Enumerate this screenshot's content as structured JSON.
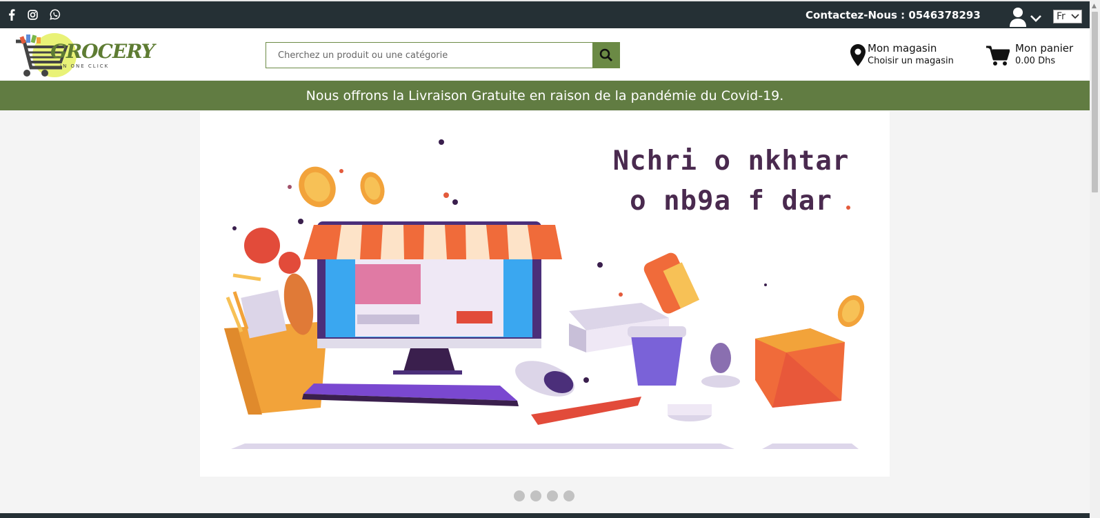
{
  "topbar": {
    "contact": "Contactez-Nous : 0546378293",
    "language": "Fr",
    "icons": [
      "facebook-icon",
      "instagram-icon",
      "whatsapp-icon",
      "user-icon",
      "chevron-down-icon"
    ]
  },
  "header": {
    "logo_text": "GROCERY",
    "logo_tagline": "IN ONE CLICK",
    "search_placeholder": "Cherchez un produit ou une catégorie",
    "store_title": "Mon magasin",
    "store_subtitle": "Choisir un magasin",
    "cart_title": "Mon panier",
    "cart_total": "0.00 Dhs"
  },
  "promo": {
    "text": "Nous offrons la Livraison Gratuite en raison de la pandémie du Covid-19."
  },
  "banner": {
    "slogan_line1": "Nchri o nkhtar",
    "slogan_line2": "o nb9a f dar",
    "slide_count": 4,
    "active_slide": 1
  },
  "colors": {
    "topbar": "#253035",
    "accent_green": "#617c42",
    "slogan": "#4a2a4f"
  }
}
